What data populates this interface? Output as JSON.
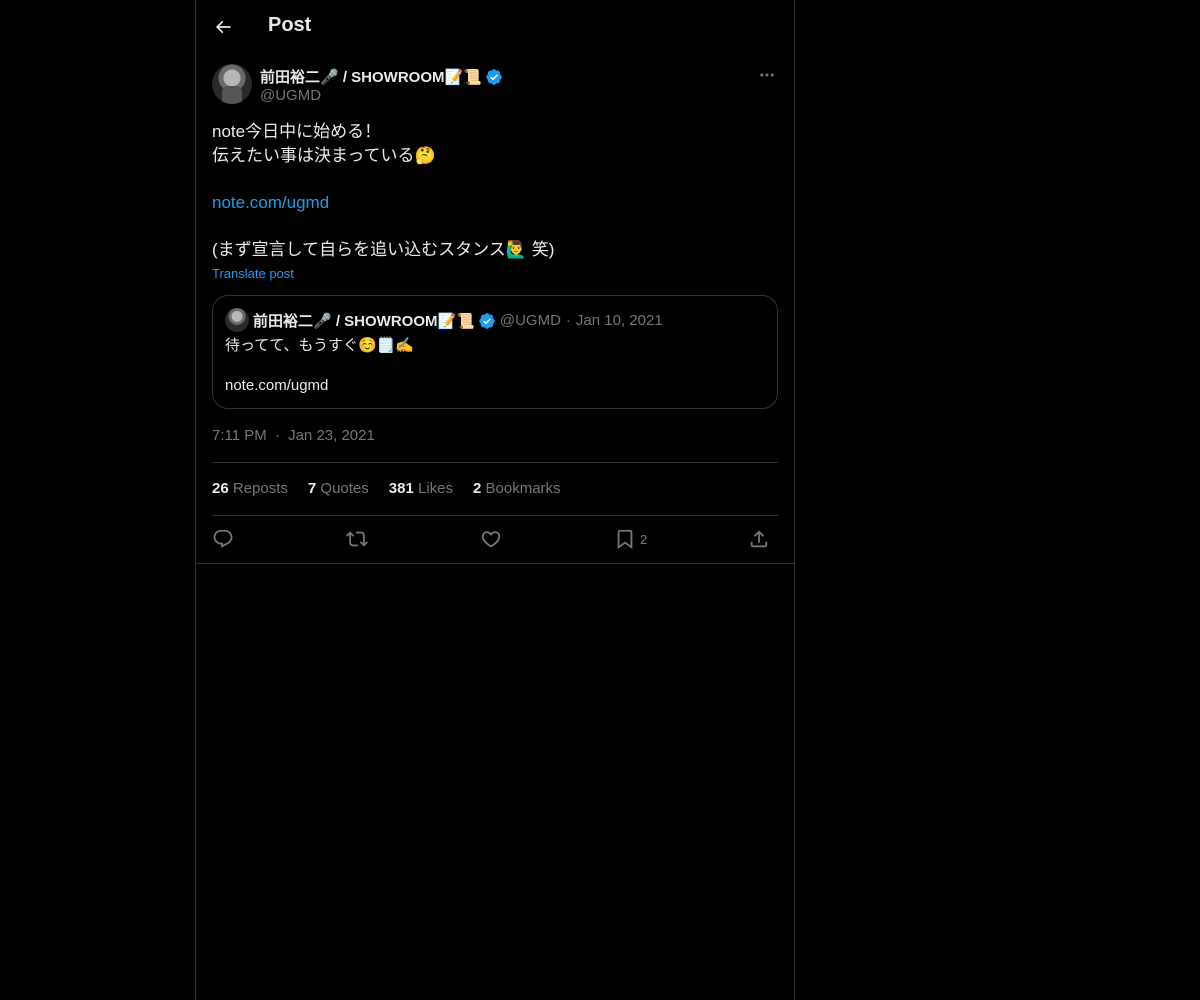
{
  "header": {
    "title": "Post"
  },
  "author": {
    "name": "前田裕二🎤 / SHOWROOM📝📜",
    "handle": "@UGMD"
  },
  "post": {
    "lines": [
      "note今日中に始める！",
      "伝えたい事は決まっている🤔"
    ],
    "link": "note.com/ugmd",
    "closing": "(まず宣言して自らを追い込むスタンス🙋‍♂️ 笑)",
    "translate_label": "Translate post"
  },
  "quote": {
    "name": "前田裕二🎤 / SHOWROOM📝📜",
    "handle": "@UGMD",
    "date": "Jan 10, 2021",
    "text": "待ってて、もうすぐ☺️🗒️✍️",
    "link": "note.com/ugmd"
  },
  "timestamp": {
    "time": "7:11 PM",
    "date": "Jan 23, 2021"
  },
  "stats": {
    "reposts_count": "26",
    "reposts_label": "Reposts",
    "quotes_count": "7",
    "quotes_label": "Quotes",
    "likes_count": "381",
    "likes_label": "Likes",
    "bookmarks_count": "2",
    "bookmarks_label": "Bookmarks"
  },
  "actions": {
    "bookmark_count": "2"
  },
  "colors": {
    "accent": "#1d9bf0",
    "muted": "#71767b",
    "border": "#2f3336"
  }
}
